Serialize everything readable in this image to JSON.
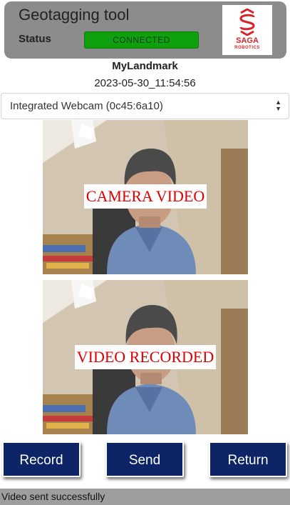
{
  "header": {
    "title": "Geotagging tool",
    "status_label": "Status",
    "status_value": "CONNECTED",
    "status_color": "#0ea10e",
    "logo": {
      "name": "SAGA",
      "sub": "ROBOTICS",
      "color": "#d6242a"
    }
  },
  "landmark": {
    "name": "MyLandmark",
    "timestamp": "2023-05-30_11:54:56"
  },
  "camera_select": {
    "selected": "Integrated Webcam (0c45:6a10)"
  },
  "videos": {
    "live_label": "CAMERA VIDEO",
    "recorded_label": "VIDEO RECORDED"
  },
  "buttons": {
    "record": "Record",
    "send": "Send",
    "return": "Return",
    "color": "#0d2466"
  },
  "status_bar": {
    "message": "Video sent successfully"
  }
}
